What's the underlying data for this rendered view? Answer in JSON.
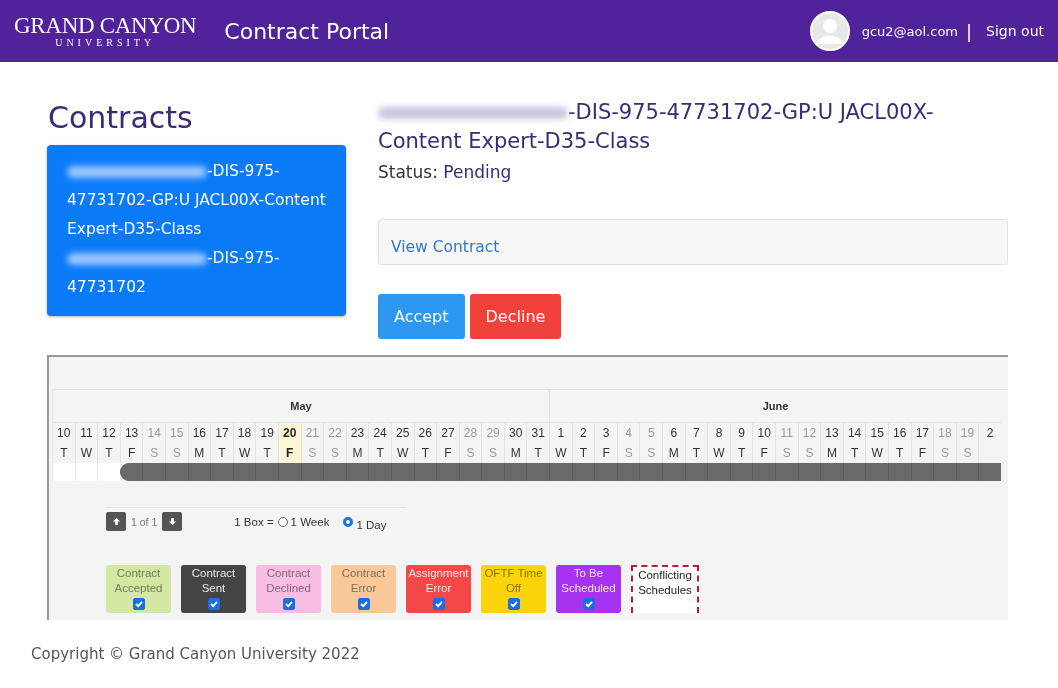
{
  "header": {
    "logo_top": "GRAND CANYON",
    "logo_bottom": "UNIVERSITY",
    "title": "Contract Portal",
    "user": "gcu2@aol.com",
    "separator": "|",
    "sign_out": "Sign out"
  },
  "sidebar": {
    "title": "Contracts",
    "items": [
      {
        "redacted": true,
        "text": "-DIS-975-47731702-GP:U JACL00X-Content Expert-D35-Class",
        "selected": true
      },
      {
        "redacted": true,
        "text": "-DIS-975-47731702",
        "selected": true
      }
    ]
  },
  "detail": {
    "redacted": true,
    "title": "-DIS-975-47731702-GP:U JACL00X-Content Expert-D35-Class",
    "status_label": "Status:",
    "status": "Pending",
    "view_link": "View Contract",
    "accept": "Accept",
    "decline": "Decline"
  },
  "calendar": {
    "months": [
      {
        "name": "May",
        "days": [
          {
            "num": "10",
            "dow": "T",
            "weekend": false,
            "today": false,
            "scheduled": false
          },
          {
            "num": "11",
            "dow": "W",
            "weekend": false,
            "today": false,
            "scheduled": false
          },
          {
            "num": "12",
            "dow": "T",
            "weekend": false,
            "today": false,
            "scheduled": false
          },
          {
            "num": "13",
            "dow": "F",
            "weekend": false,
            "today": false,
            "scheduled": true
          },
          {
            "num": "14",
            "dow": "S",
            "weekend": true,
            "today": false,
            "scheduled": true
          },
          {
            "num": "15",
            "dow": "S",
            "weekend": true,
            "today": false,
            "scheduled": true
          },
          {
            "num": "16",
            "dow": "M",
            "weekend": false,
            "today": false,
            "scheduled": true
          },
          {
            "num": "17",
            "dow": "T",
            "weekend": false,
            "today": false,
            "scheduled": true
          },
          {
            "num": "18",
            "dow": "W",
            "weekend": false,
            "today": false,
            "scheduled": true
          },
          {
            "num": "19",
            "dow": "T",
            "weekend": false,
            "today": false,
            "scheduled": true
          },
          {
            "num": "20",
            "dow": "F",
            "weekend": false,
            "today": true,
            "scheduled": true
          },
          {
            "num": "21",
            "dow": "S",
            "weekend": true,
            "today": false,
            "scheduled": true
          },
          {
            "num": "22",
            "dow": "S",
            "weekend": true,
            "today": false,
            "scheduled": true
          },
          {
            "num": "23",
            "dow": "M",
            "weekend": false,
            "today": false,
            "scheduled": true
          },
          {
            "num": "24",
            "dow": "T",
            "weekend": false,
            "today": false,
            "scheduled": true
          },
          {
            "num": "25",
            "dow": "W",
            "weekend": false,
            "today": false,
            "scheduled": true
          },
          {
            "num": "26",
            "dow": "T",
            "weekend": false,
            "today": false,
            "scheduled": true
          },
          {
            "num": "27",
            "dow": "F",
            "weekend": false,
            "today": false,
            "scheduled": true
          },
          {
            "num": "28",
            "dow": "S",
            "weekend": true,
            "today": false,
            "scheduled": true
          },
          {
            "num": "29",
            "dow": "S",
            "weekend": true,
            "today": false,
            "scheduled": true
          },
          {
            "num": "30",
            "dow": "M",
            "weekend": false,
            "today": false,
            "scheduled": true
          },
          {
            "num": "31",
            "dow": "T",
            "weekend": false,
            "today": false,
            "scheduled": true
          }
        ]
      },
      {
        "name": "June",
        "days": [
          {
            "num": "1",
            "dow": "W",
            "weekend": false,
            "today": false,
            "scheduled": true
          },
          {
            "num": "2",
            "dow": "T",
            "weekend": false,
            "today": false,
            "scheduled": true
          },
          {
            "num": "3",
            "dow": "F",
            "weekend": false,
            "today": false,
            "scheduled": true
          },
          {
            "num": "4",
            "dow": "S",
            "weekend": true,
            "today": false,
            "scheduled": true
          },
          {
            "num": "5",
            "dow": "S",
            "weekend": true,
            "today": false,
            "scheduled": true
          },
          {
            "num": "6",
            "dow": "M",
            "weekend": false,
            "today": false,
            "scheduled": true
          },
          {
            "num": "7",
            "dow": "T",
            "weekend": false,
            "today": false,
            "scheduled": true
          },
          {
            "num": "8",
            "dow": "W",
            "weekend": false,
            "today": false,
            "scheduled": true
          },
          {
            "num": "9",
            "dow": "T",
            "weekend": false,
            "today": false,
            "scheduled": true
          },
          {
            "num": "10",
            "dow": "F",
            "weekend": false,
            "today": false,
            "scheduled": true
          },
          {
            "num": "11",
            "dow": "S",
            "weekend": true,
            "today": false,
            "scheduled": true
          },
          {
            "num": "12",
            "dow": "S",
            "weekend": true,
            "today": false,
            "scheduled": true
          },
          {
            "num": "13",
            "dow": "M",
            "weekend": false,
            "today": false,
            "scheduled": true
          },
          {
            "num": "14",
            "dow": "T",
            "weekend": false,
            "today": false,
            "scheduled": true
          },
          {
            "num": "15",
            "dow": "W",
            "weekend": false,
            "today": false,
            "scheduled": true
          },
          {
            "num": "16",
            "dow": "T",
            "weekend": false,
            "today": false,
            "scheduled": true
          },
          {
            "num": "17",
            "dow": "F",
            "weekend": false,
            "today": false,
            "scheduled": true
          },
          {
            "num": "18",
            "dow": "S",
            "weekend": true,
            "today": false,
            "scheduled": true
          },
          {
            "num": "19",
            "dow": "S",
            "weekend": true,
            "today": false,
            "scheduled": true
          },
          {
            "num": "2",
            "weekend": false,
            "today": false,
            "scheduled": true
          }
        ]
      }
    ],
    "pager": "1 of 1",
    "box_label": "1 Box =",
    "scale_options": [
      {
        "label": "1 Week",
        "selected": false
      },
      {
        "label": "1 Day",
        "selected": true
      }
    ],
    "legend": [
      {
        "kind": "checkbox",
        "label": "Contract Accepted",
        "color": "#d4e8a4",
        "checked": true
      },
      {
        "kind": "checkbox",
        "label": "Contract Sent",
        "color": "#444446",
        "checked": true
      },
      {
        "kind": "checkbox",
        "label": "Contract Declined",
        "color": "#f7bde2",
        "checked": true
      },
      {
        "kind": "checkbox",
        "label": "Contract Error",
        "color": "#f8c899",
        "checked": true
      },
      {
        "kind": "checkbox",
        "label": "Assignment Error",
        "color": "#f34848",
        "checked": true
      },
      {
        "kind": "checkbox",
        "label": "OFTF Time Off",
        "color": "#fcd40c",
        "checked": true
      },
      {
        "kind": "checkbox",
        "label": "To Be Scheduled",
        "color": "#a633f0",
        "checked": true
      },
      {
        "kind": "dashed",
        "label": "Conflicting Schedules",
        "color": "#b02030"
      }
    ]
  },
  "footer": "Copyright © Grand Canyon University 2022"
}
